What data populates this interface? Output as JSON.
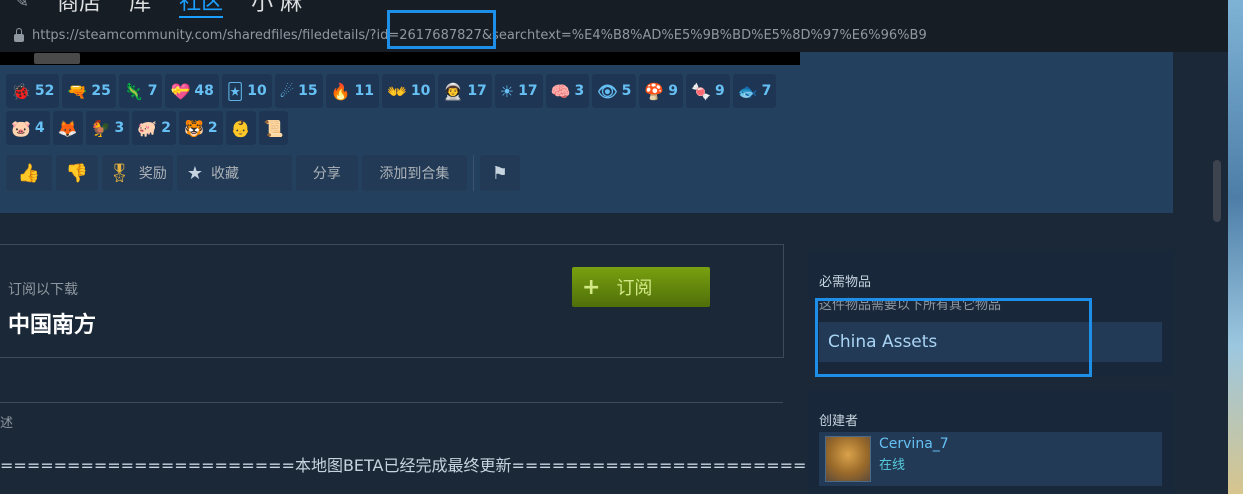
{
  "nav": {
    "back_glyph": "✎",
    "items": [
      "商店",
      "库",
      "社区",
      "小 麻"
    ]
  },
  "url": "https://steamcommunity.com/sharedfiles/filedetails/?id=2617687827&searchtext=%E4%B8%AD%E5%9B%BD%E5%8D%97%E6%96%B9",
  "awards": [
    {
      "icon": "bug-icon",
      "glyph": "🐞",
      "count": "52"
    },
    {
      "icon": "gun-icon",
      "glyph": "🔫",
      "count": "25"
    },
    {
      "icon": "lizard-icon",
      "glyph": "🦎",
      "count": "7"
    },
    {
      "icon": "heart-box-icon",
      "glyph": "💝",
      "count": "48"
    },
    {
      "icon": "card-icon",
      "glyph": "🃏",
      "count": "10"
    },
    {
      "icon": "comet-icon",
      "glyph": "☄",
      "count": "15"
    },
    {
      "icon": "fire-hut-icon",
      "glyph": "🔥",
      "count": "11"
    },
    {
      "icon": "hands-icon",
      "glyph": "👐",
      "count": "10"
    },
    {
      "icon": "astronaut-icon",
      "glyph": "👨‍🚀",
      "count": "17"
    },
    {
      "icon": "sun-icon",
      "glyph": "☀",
      "count": "17"
    },
    {
      "icon": "brain-icon",
      "glyph": "🧠",
      "count": "3"
    },
    {
      "icon": "eye-icon",
      "glyph": "👁",
      "count": "5"
    },
    {
      "icon": "mushroom-icon",
      "glyph": "🍄",
      "count": "9"
    },
    {
      "icon": "candy-icon",
      "glyph": "🍬",
      "count": "9"
    },
    {
      "icon": "fish-icon",
      "glyph": "🐟",
      "count": "7"
    },
    {
      "icon": "pig-icon",
      "glyph": "🐷",
      "count": "4"
    },
    {
      "icon": "fox-icon",
      "glyph": "🦊",
      "count": ""
    },
    {
      "icon": "rooster-icon",
      "glyph": "🐓",
      "count": "3"
    },
    {
      "icon": "pig-heart-icon",
      "glyph": "🐖",
      "count": "2"
    },
    {
      "icon": "tiger-icon",
      "glyph": "🐯",
      "count": "2"
    },
    {
      "icon": "baby-icon",
      "glyph": "👶",
      "count": ""
    },
    {
      "icon": "scroll-icon",
      "glyph": "📜",
      "count": ""
    }
  ],
  "actions": {
    "thumbs_up_glyph": "👍",
    "thumbs_down_glyph": "👎",
    "award_glyph": "🎖",
    "award_label": "奖励",
    "favorite_glyph": "★",
    "favorite_label": "收藏",
    "share_label": "分享",
    "add_to_collection_label": "添加到合集",
    "flag_glyph": "⚑"
  },
  "subscribe": {
    "hint": "订阅以下载",
    "title": "中国南方",
    "button_plus": "+",
    "button_label": "订阅"
  },
  "description": {
    "label": "述",
    "text": "======================本地图BETA已经完成最终更新======================="
  },
  "required": {
    "heading": "必需物品",
    "subheading": "这件物品需要以下所有其它物品",
    "item": "China Assets"
  },
  "creator": {
    "heading": "创建者",
    "name": "Cervina_7",
    "status": "在线"
  },
  "colors": {
    "accent": "#1a9fff",
    "highlight": "#1e8fe8",
    "subscribe_green": "#79a00f",
    "link": "#66c0f4"
  }
}
